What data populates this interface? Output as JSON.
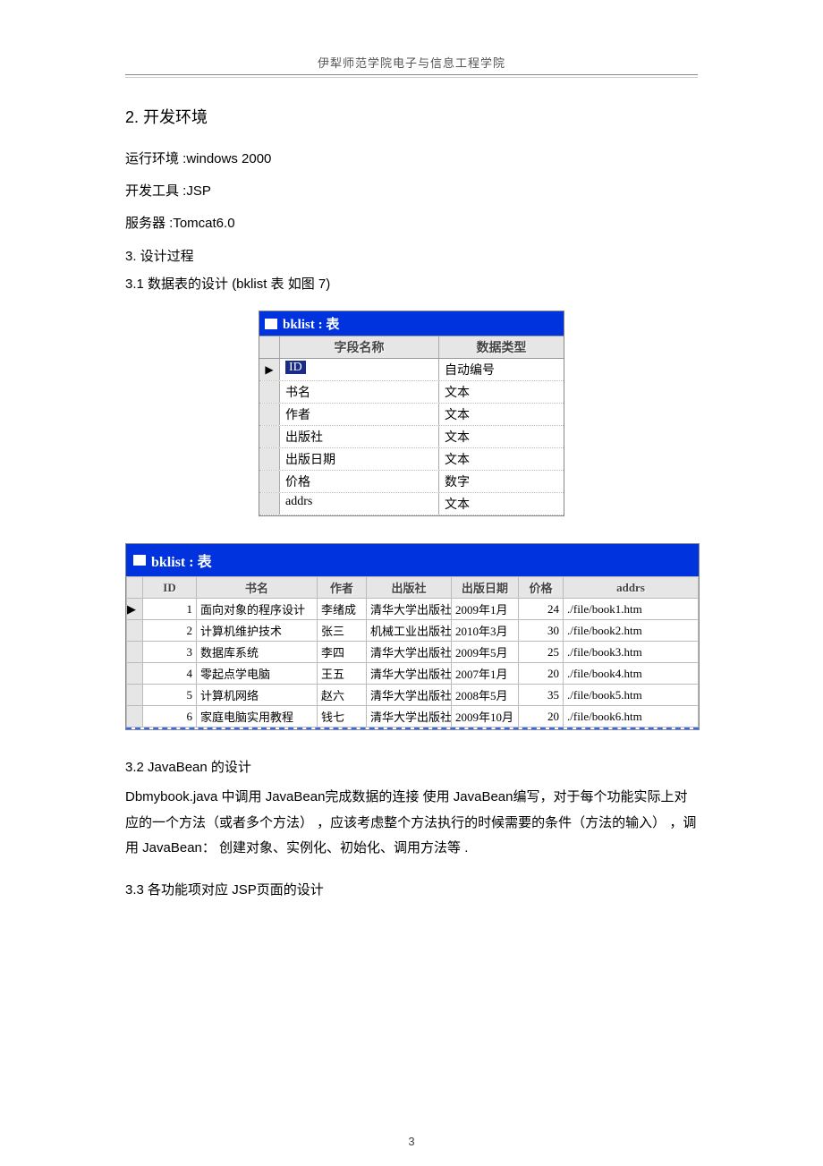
{
  "header": {
    "institution": "伊犁师范学院电子与信息工程学院"
  },
  "sections": {
    "s2_title": "2. 开发环境",
    "env_runtime": "运行环境 :windows 2000",
    "env_tool": "开发工具 :JSP",
    "env_server": "服务器 :Tomcat6.0",
    "s3_title": "3. 设计过程",
    "s31_title": "3.1  数据表的设计 (bklist    表  如图 7)",
    "s32_title": "3.2 JavaBean  的设计",
    "s32_para": "Dbmybook.java 中调用 JavaBean完成数据的连接 使用 JavaBean编写，对于每个功能实际上对应的一个方法（或者多个方法） ，应该考虑整个方法执行的时候需要的条件（方法的输入） ，调用 JavaBean： 创建对象、实例化、初始化、调用方法等 .",
    "s33_title": "3.3  各功能项对应  JSP页面的设计"
  },
  "schema_window": {
    "title": "bklist : 表",
    "col_field": "字段名称",
    "col_type": "数据类型",
    "active_marker": "▶",
    "rows": [
      {
        "field": "ID",
        "highlight": true,
        "type": "自动编号"
      },
      {
        "field": "书名",
        "highlight": false,
        "type": "文本"
      },
      {
        "field": "作者",
        "highlight": false,
        "type": "文本"
      },
      {
        "field": "出版社",
        "highlight": false,
        "type": "文本"
      },
      {
        "field": "出版日期",
        "highlight": false,
        "type": "文本"
      },
      {
        "field": "价格",
        "highlight": false,
        "type": "数字"
      },
      {
        "field": "addrs",
        "highlight": false,
        "type": "文本"
      }
    ]
  },
  "data_window": {
    "title": "bklist : 表",
    "columns": [
      "ID",
      "书名",
      "作者",
      "出版社",
      "出版日期",
      "价格",
      "addrs"
    ],
    "active_marker": "▶",
    "rows": [
      {
        "id": "1",
        "name": "面向对象的程序设计",
        "author": "李绪成",
        "pub": "清华大学出版社",
        "date": "2009年1月",
        "price": "24",
        "addrs": "./file/book1.htm",
        "active": true
      },
      {
        "id": "2",
        "name": "计算机维护技术",
        "author": "张三",
        "pub": "机械工业出版社",
        "date": "2010年3月",
        "price": "30",
        "addrs": "./file/book2.htm",
        "active": false
      },
      {
        "id": "3",
        "name": "数据库系统",
        "author": "李四",
        "pub": "清华大学出版社",
        "date": "2009年5月",
        "price": "25",
        "addrs": "./file/book3.htm",
        "active": false
      },
      {
        "id": "4",
        "name": "零起点学电脑",
        "author": "王五",
        "pub": "清华大学出版社",
        "date": "2007年1月",
        "price": "20",
        "addrs": "./file/book4.htm",
        "active": false
      },
      {
        "id": "5",
        "name": "计算机网络",
        "author": "赵六",
        "pub": "清华大学出版社",
        "date": "2008年5月",
        "price": "35",
        "addrs": "./file/book5.htm",
        "active": false
      },
      {
        "id": "6",
        "name": "家庭电脑实用教程",
        "author": "钱七",
        "pub": "清华大学出版社",
        "date": "2009年10月",
        "price": "20",
        "addrs": "./file/book6.htm",
        "active": false
      }
    ]
  },
  "page_number": "3"
}
